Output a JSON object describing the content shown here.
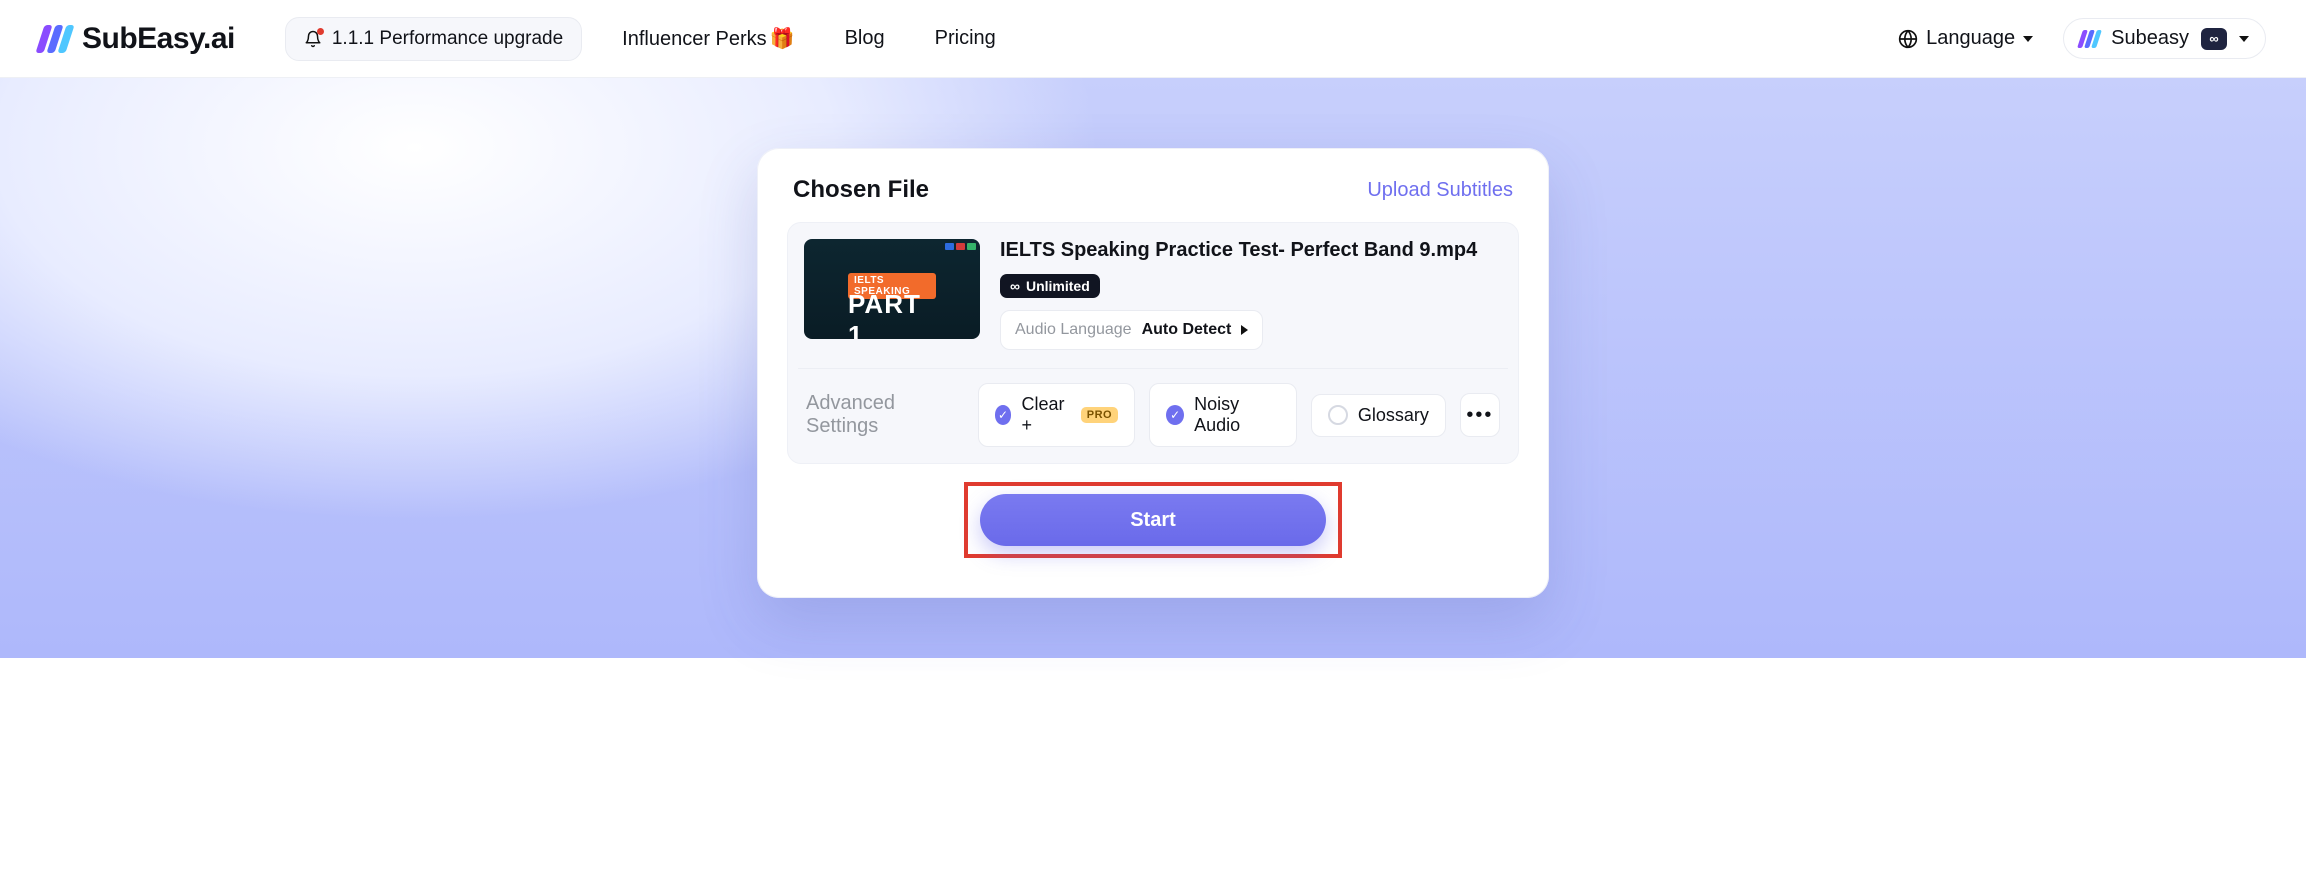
{
  "brand": {
    "name": "SubEasy.ai"
  },
  "topbar": {
    "update_pill": "1.1.1 Performance upgrade",
    "nav": {
      "influencer": "Influencer Perks",
      "blog": "Blog",
      "pricing": "Pricing"
    },
    "language_label": "Language",
    "user_name": "Subeasy",
    "infinity_badge": "∞"
  },
  "card": {
    "title": "Chosen File",
    "upload_link": "Upload Subtitles",
    "file": {
      "name": "IELTS Speaking Practice Test- Perfect Band 9.mp4",
      "unlimited_label": "Unlimited",
      "thumb_ribbon": "IELTS SPEAKING",
      "thumb_big": "PART 1"
    },
    "audio_lang": {
      "label": "Audio Language",
      "value": "Auto Detect"
    },
    "advanced_label": "Advanced Settings",
    "options": {
      "clear_label": "Clear +",
      "pro_badge": "PRO",
      "noisy_label": "Noisy Audio",
      "glossary_label": "Glossary"
    },
    "more_symbol": "•••",
    "start_label": "Start"
  }
}
